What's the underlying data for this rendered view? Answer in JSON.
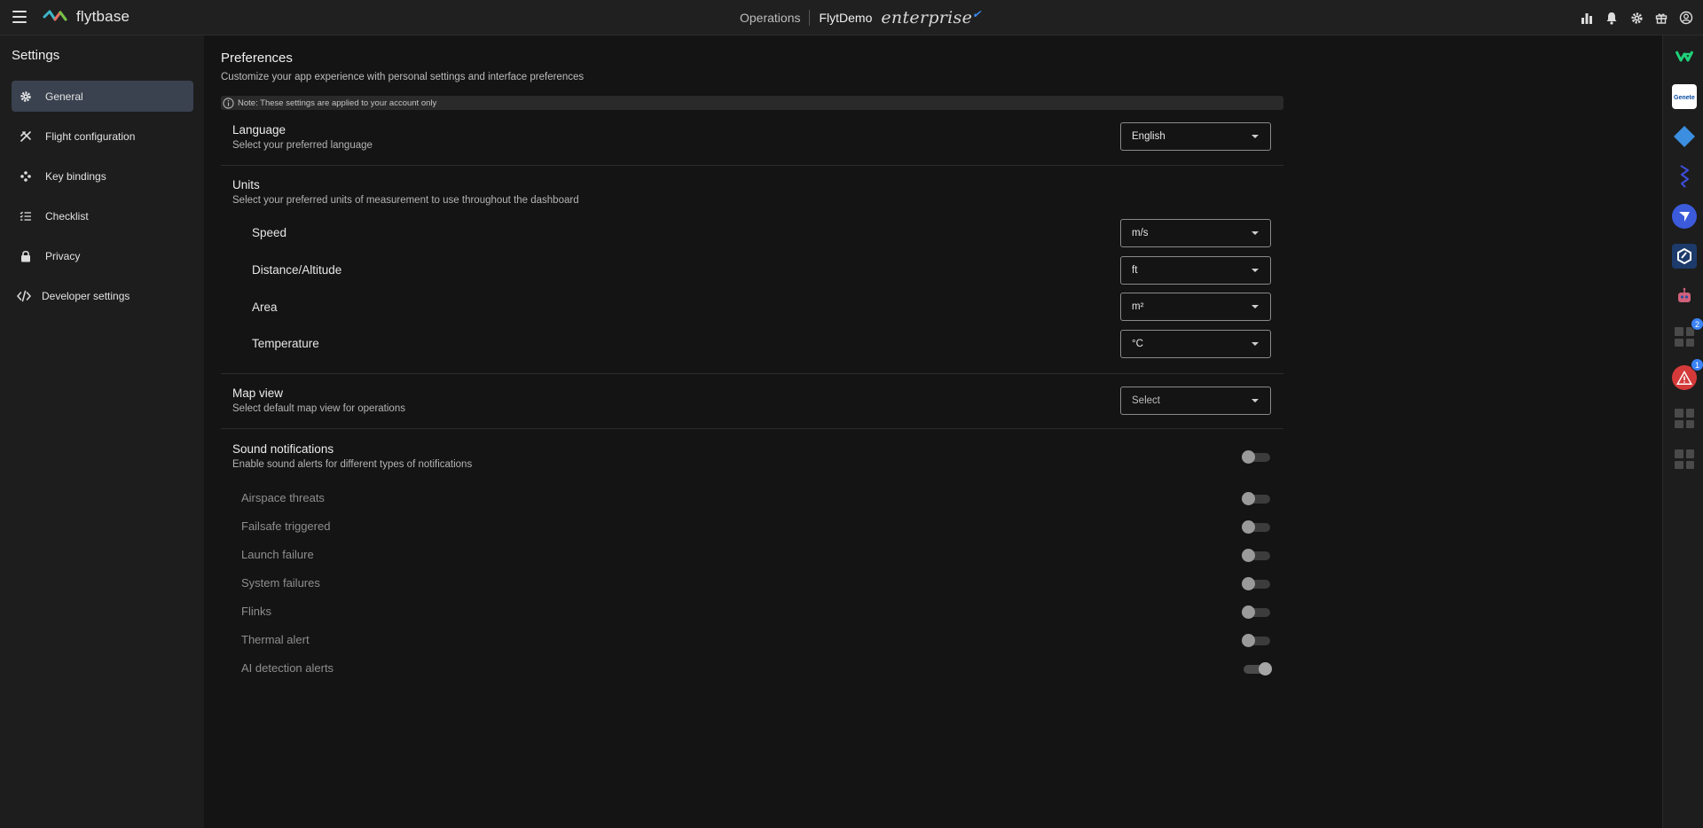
{
  "topbar": {
    "menu_icon": "hamburger-menu-icon",
    "brand": "flytbase",
    "operations": "Operations",
    "org_name": "FlytDemo",
    "plan": "enterprise",
    "icons": [
      "bar-chart-icon",
      "bell-icon",
      "gear-icon",
      "gift-icon",
      "user-circle-icon"
    ]
  },
  "sidebar": {
    "title": "Settings",
    "items": [
      {
        "label": "General",
        "icon": "gear-icon",
        "active": true
      },
      {
        "label": "Flight configuration",
        "icon": "drone-icon",
        "active": false
      },
      {
        "label": "Key bindings",
        "icon": "gamepad-icon",
        "active": false
      },
      {
        "label": "Checklist",
        "icon": "checklist-icon",
        "active": false
      },
      {
        "label": "Privacy",
        "icon": "lock-icon",
        "active": false
      },
      {
        "label": "Developer settings",
        "icon": "code-icon",
        "active": false
      }
    ]
  },
  "main": {
    "title": "Preferences",
    "subtitle": "Customize your app experience with personal settings and interface preferences",
    "note": "Note: These settings are applied to your account only",
    "language": {
      "title": "Language",
      "subtitle": "Select your preferred language",
      "value": "English"
    },
    "units": {
      "title": "Units",
      "subtitle": "Select your preferred units of measurement to use throughout the dashboard",
      "speed": {
        "label": "Speed",
        "value": "m/s"
      },
      "distance": {
        "label": "Distance/Altitude",
        "value": "ft"
      },
      "area": {
        "label": "Area",
        "value": "m²"
      },
      "temperature": {
        "label": "Temperature",
        "value": "°C"
      }
    },
    "map_view": {
      "title": "Map view",
      "subtitle": "Select default map view for operations",
      "placeholder": "Select"
    },
    "sound": {
      "title": "Sound notifications",
      "subtitle": "Enable sound alerts for different types of notifications",
      "enabled": false,
      "items": [
        {
          "label": "Airspace threats",
          "on": false
        },
        {
          "label": "Failsafe triggered",
          "on": false
        },
        {
          "label": "Launch failure",
          "on": false
        },
        {
          "label": "System failures",
          "on": false
        },
        {
          "label": "Flinks",
          "on": false
        },
        {
          "label": "Thermal alert",
          "on": false
        },
        {
          "label": "AI detection alerts",
          "on": true
        }
      ]
    }
  },
  "dock": {
    "items": [
      {
        "icon": "va-logo-icon",
        "color": "#1fd17a"
      },
      {
        "icon": "genetec-logo-icon",
        "color": "#ffffff"
      },
      {
        "icon": "diamond-icon",
        "color": "#3b8ee0"
      },
      {
        "icon": "lightning-icon",
        "color": "#3d4dd8"
      },
      {
        "icon": "send-icon",
        "color": "#3b5bdb"
      },
      {
        "icon": "hexagon-icon",
        "color": "#2d6fd6"
      },
      {
        "icon": "robot-icon",
        "color": "#d0607a"
      },
      {
        "icon": "apps-placeholder-icon",
        "badge": "2"
      },
      {
        "icon": "warning-icon",
        "badge": "1",
        "color": "#d43a3a"
      },
      {
        "icon": "apps-placeholder-icon"
      },
      {
        "icon": "apps-placeholder-icon"
      }
    ]
  }
}
